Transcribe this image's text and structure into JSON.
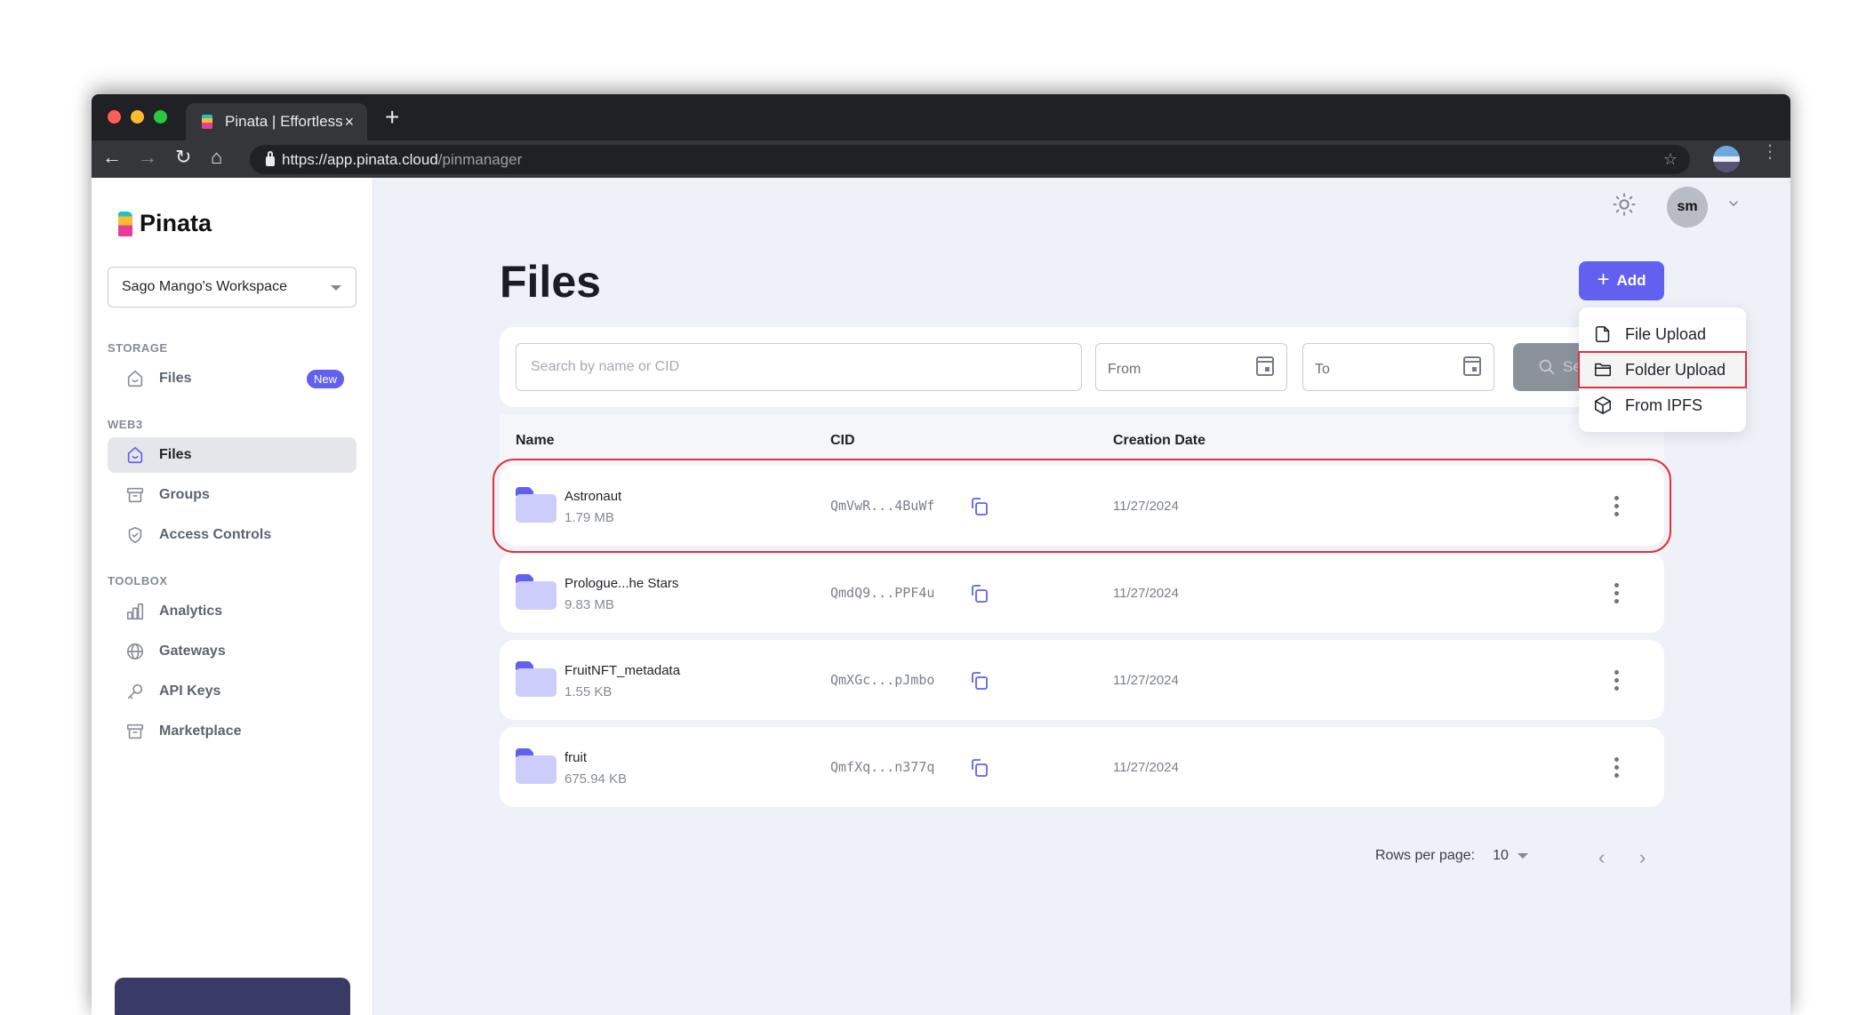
{
  "browser": {
    "tab_title": "Pinata | Effortless",
    "tab_close": "×",
    "new_tab": "+",
    "url_host": "https://app.pinata.cloud",
    "url_path": "/pinmanager",
    "back": "←",
    "forward": "→",
    "reload": "↻",
    "home": "⌂",
    "star": "☆",
    "menu": "⋮"
  },
  "sidebar": {
    "logo_text": "Pinata",
    "workspace": "Sago Mango's Workspace",
    "sections": [
      {
        "label": "STORAGE",
        "items": [
          {
            "label": "Files",
            "icon": "home-icon",
            "badge": "New"
          }
        ]
      },
      {
        "label": "WEB3",
        "items": [
          {
            "label": "Files",
            "icon": "home-icon",
            "active": true
          },
          {
            "label": "Groups",
            "icon": "archive-icon"
          },
          {
            "label": "Access Controls",
            "icon": "shield-check-icon"
          }
        ]
      },
      {
        "label": "TOOLBOX",
        "items": [
          {
            "label": "Analytics",
            "icon": "bar-chart-icon"
          },
          {
            "label": "Gateways",
            "icon": "globe-icon"
          },
          {
            "label": "API Keys",
            "icon": "key-icon"
          },
          {
            "label": "Marketplace",
            "icon": "archive-icon"
          }
        ]
      }
    ]
  },
  "header": {
    "avatar_initials": "sm",
    "theme_icon": "sun-icon"
  },
  "main": {
    "title": "Files",
    "add_label": "Add",
    "add_menu": [
      {
        "label": "File Upload",
        "icon": "file-icon"
      },
      {
        "label": "Folder Upload",
        "icon": "folder-icon",
        "selected": true
      },
      {
        "label": "From IPFS",
        "icon": "cube-icon"
      }
    ],
    "search_placeholder": "Search by name or CID",
    "from_label": "From",
    "to_label": "To",
    "search_button": "Search",
    "columns": [
      "Name",
      "CID",
      "Creation Date"
    ],
    "rows": [
      {
        "name": "Astronaut",
        "size": "1.79 MB",
        "cid": "QmVwR...4BuWf",
        "date": "11/27/2024",
        "highlight": true
      },
      {
        "name": "Prologue...he Stars",
        "size": "9.83 MB",
        "cid": "QmdQ9...PPF4u",
        "date": "11/27/2024"
      },
      {
        "name": "FruitNFT_metadata",
        "size": "1.55 KB",
        "cid": "QmXGc...pJmbo",
        "date": "11/27/2024"
      },
      {
        "name": "fruit",
        "size": "675.94 KB",
        "cid": "QmfXq...n377q",
        "date": "11/27/2024"
      }
    ],
    "rows_per_page_label": "Rows per page:",
    "rows_per_page": "10",
    "prev": "‹",
    "next": "›"
  },
  "colors": {
    "accent": "#6160f0",
    "highlight_border": "#e0323b",
    "folder_light": "#cdcdfb",
    "folder_dark": "#6160f0"
  }
}
